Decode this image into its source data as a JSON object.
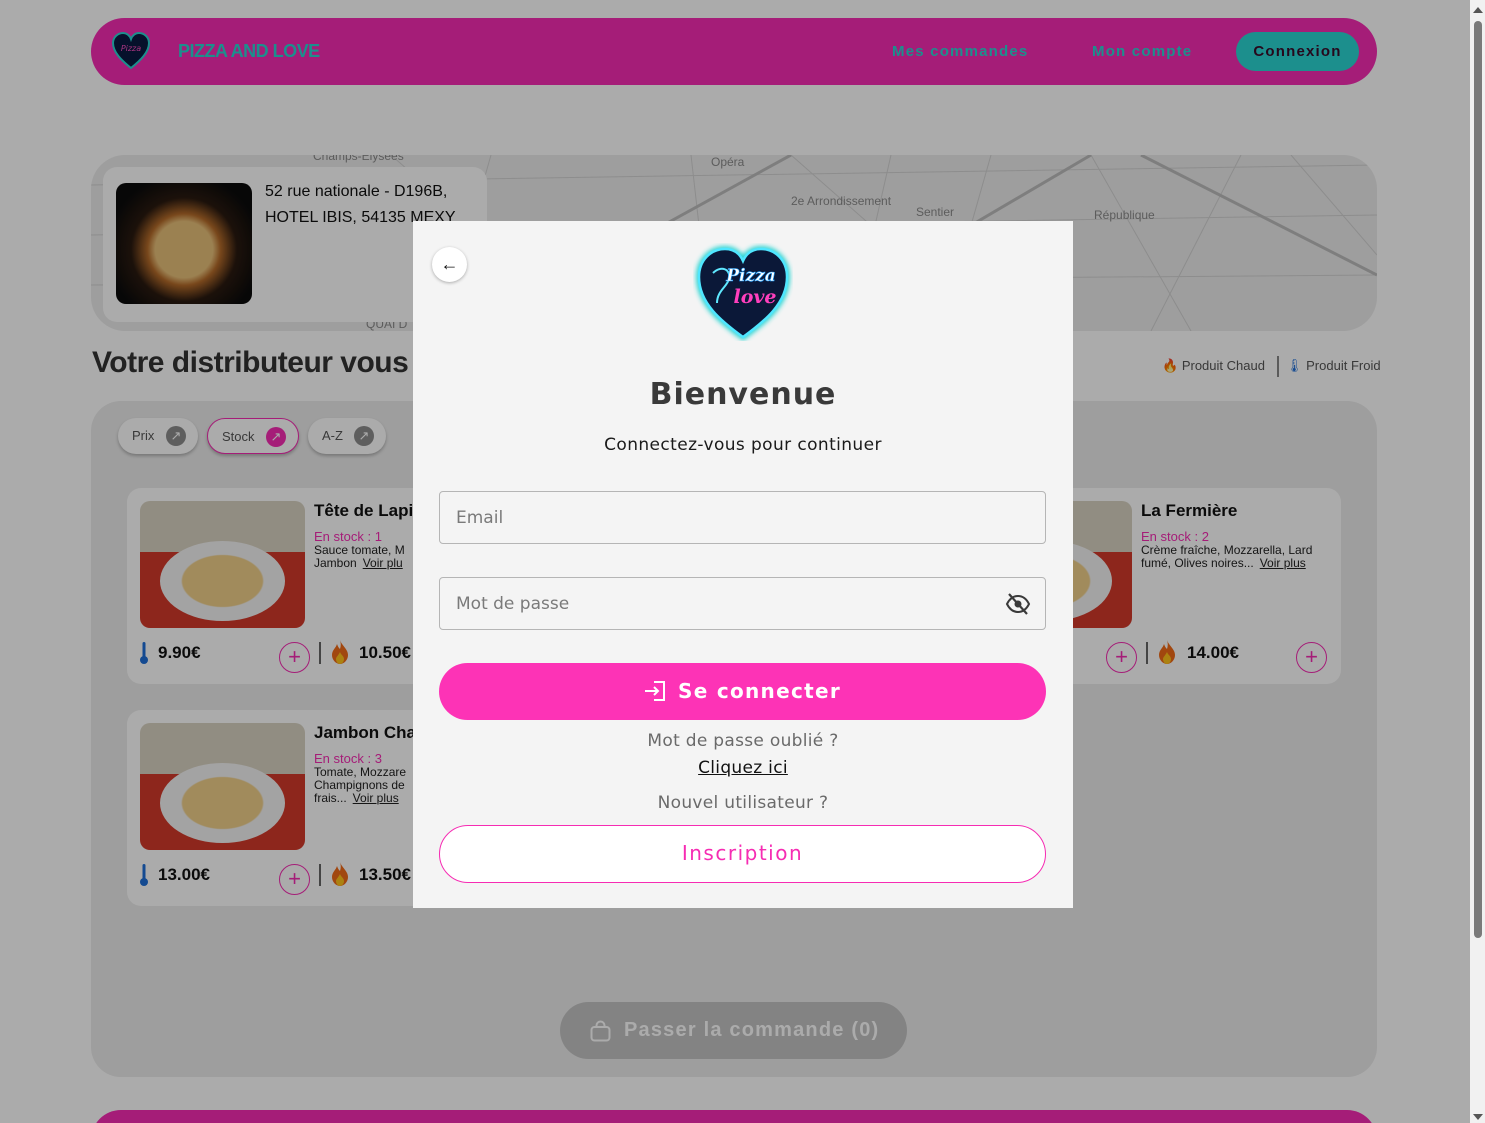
{
  "header": {
    "brand_name": "PIZZA AND LOVE",
    "nav": {
      "orders": "Mes commandes",
      "account": "Mon compte",
      "login": "Connexion"
    }
  },
  "map": {
    "labels": [
      "Champs-Élysées",
      "Opéra",
      "2e Arrondissement",
      "Sentier",
      "République",
      "QUAI D"
    ]
  },
  "distributor": {
    "address": "52 rue nationale - D196B, HOTEL IBIS, 54135 MEXY"
  },
  "section_title": "Votre distributeur vous pr",
  "legend": {
    "hot": "Produit Chaud",
    "cold": "Produit Froid"
  },
  "filters": {
    "price": "Prix",
    "stock": "Stock",
    "az": "A-Z"
  },
  "products": [
    {
      "name": "Tête de Lapi",
      "stock": "En stock : 1",
      "desc": "Sauce tomate, M Jambon",
      "more": "Voir plu",
      "cold_price": "9.90€",
      "hot_price": "10.50€"
    },
    {
      "name": "La Fermière",
      "stock": "En stock : 2",
      "desc": "Crème fraîche, Mozzarella, Lard fumé, Olives noires...",
      "more": "Voir plus",
      "cold_price": "",
      "hot_price": "14.00€"
    },
    {
      "name": "Jambon Cha",
      "stock": "En stock : 3",
      "desc": "Tomate, Mozzare Champignons de frais...",
      "more": "Voir plus",
      "cold_price": "13.00€",
      "hot_price": "13.50€"
    }
  ],
  "order_button": "Passer la commande (0)",
  "modal": {
    "title": "Bienvenue",
    "subtitle": "Connectez-vous pour continuer",
    "email_placeholder": "Email",
    "email_value": "",
    "password_placeholder": "Mot de passe",
    "password_value": "",
    "login_button": "Se connecter",
    "forgot_text": "Mot de passe oublié ?",
    "click_here": "Cliquez ici",
    "new_user": "Nouvel utilisateur ?",
    "signup_button": "Inscription"
  },
  "colors": {
    "brand_pink": "#f62cb3",
    "brand_cyan": "#2ad6d3",
    "button_pink": "#fd33b6"
  }
}
